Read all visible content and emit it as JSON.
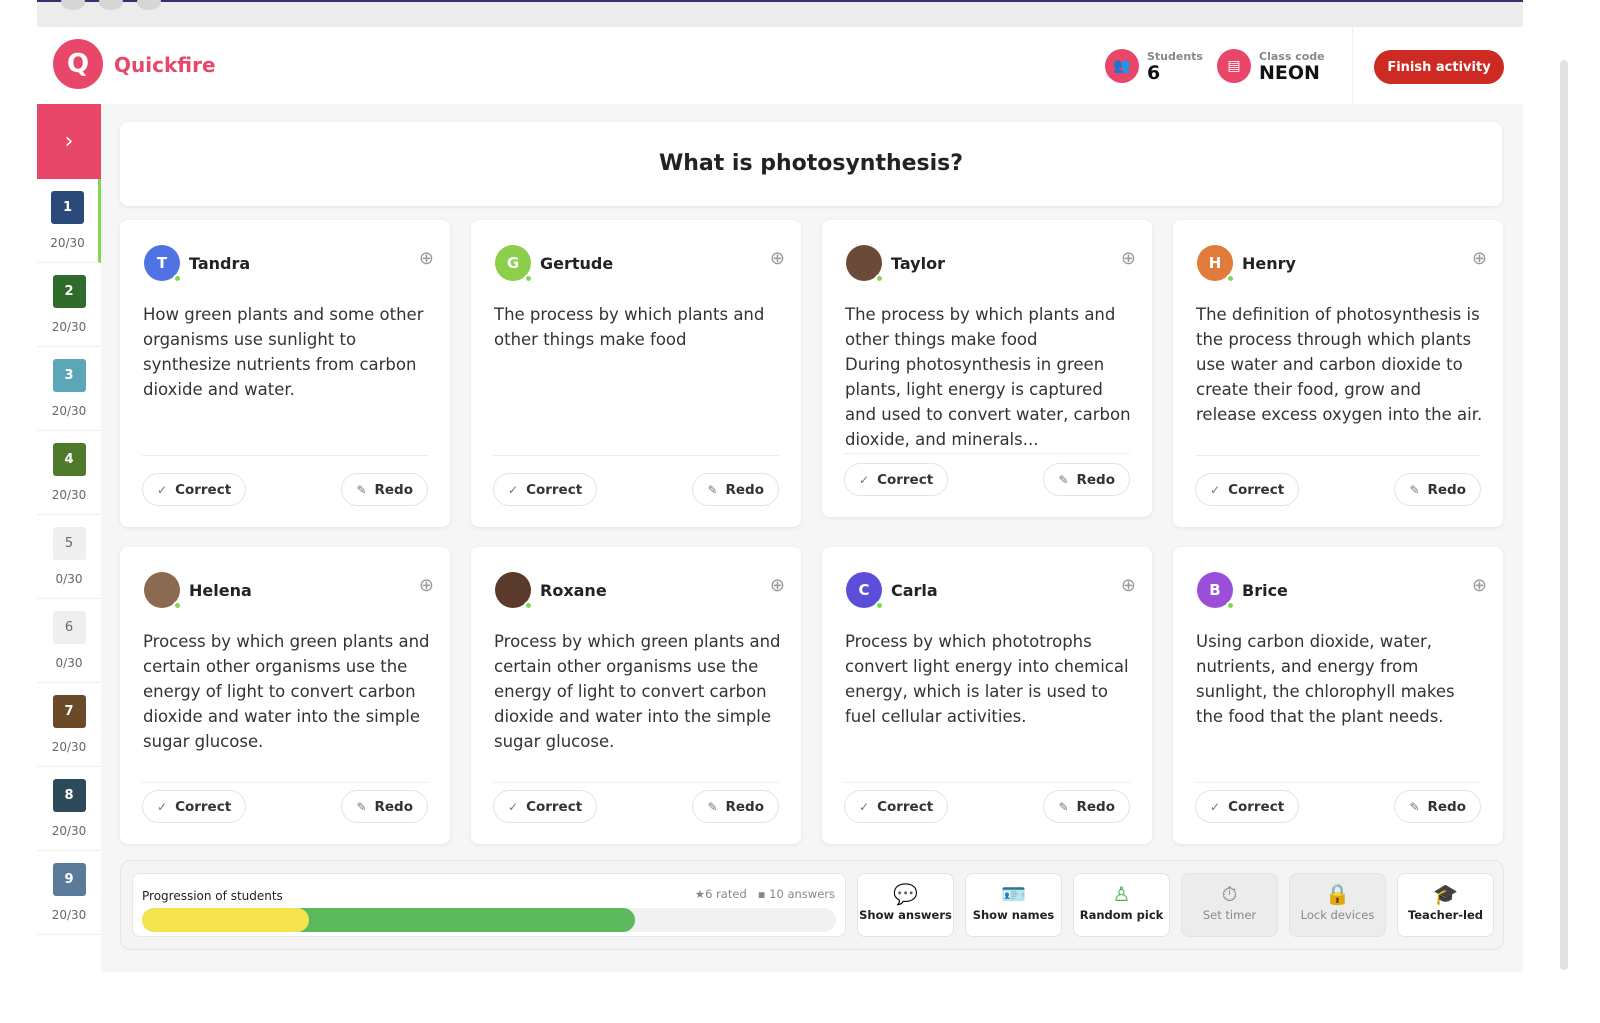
{
  "header": {
    "brand": "Quickfire",
    "students_label": "Students",
    "students_value": "6",
    "class_code_label": "Class code",
    "class_code_value": "NEON",
    "finish_label": "Finish activity"
  },
  "sidebar": {
    "items": [
      {
        "number": "1",
        "count": "20/30",
        "color": "#2b4a7a"
      },
      {
        "number": "2",
        "count": "20/30",
        "color": "#2f6b2a"
      },
      {
        "number": "3",
        "count": "20/30",
        "color": "#5ba7b8"
      },
      {
        "number": "4",
        "count": "20/30",
        "color": "#4f7a2c"
      },
      {
        "number": "5",
        "count": "0/30"
      },
      {
        "number": "6",
        "count": "0/30"
      },
      {
        "number": "7",
        "count": "20/30",
        "color": "#6b4a2a"
      },
      {
        "number": "8",
        "count": "20/30",
        "color": "#2d4a5a"
      },
      {
        "number": "9",
        "count": "20/30",
        "color": "#5a7a9a"
      }
    ]
  },
  "question": "What is photosynthesis?",
  "cards": [
    {
      "name": "Tandra",
      "initial": "T",
      "color": "#4f73e3",
      "answer": "How  green plants and some other organisms use sunlight to synthesize nutrients from carbon dioxide and water."
    },
    {
      "name": "Gertude",
      "initial": "G",
      "color": "#8bcf4a",
      "answer": "The process by which plants and other things make food"
    },
    {
      "name": "Taylor",
      "initial": "",
      "color": "#6b4a3a",
      "answer": "The process by which plants and other things make food\nDuring photosynthesis in green plants, light energy is captured and used to convert water, carbon dioxide, and minerals..."
    },
    {
      "name": "Henry",
      "initial": "H",
      "color": "#e07b3a",
      "answer": "The definition of photosynthesis is the process through which plants use water and carbon dioxide to create their food, grow and release excess oxygen into the air."
    },
    {
      "name": "Helena",
      "initial": "",
      "color": "#8a6a50",
      "answer": "Process by which green plants and certain other organisms use the energy of light to convert carbon dioxide and water into the simple sugar glucose."
    },
    {
      "name": "Roxane",
      "initial": "",
      "color": "#5a3a2a",
      "answer": "Process by which green plants and certain other organisms use the energy of light to convert carbon dioxide and water into the simple sugar glucose."
    },
    {
      "name": "Carla",
      "initial": "C",
      "color": "#5b4fd9",
      "answer": "Process by which phototrophs convert light energy into chemical energy, which is later is used to fuel cellular activities."
    },
    {
      "name": "Brice",
      "initial": "B",
      "color": "#9b4fd9",
      "answer": "Using carbon dioxide, water, nutrients, and energy from sunlight, the chlorophyll makes the food that the plant needs."
    }
  ],
  "card_buttons": {
    "correct": "Correct",
    "redo": "Redo"
  },
  "progress": {
    "title": "Progression of students",
    "rated": "6 rated",
    "answers": "10 answers",
    "rated_percent": 24,
    "answered_percent": 71,
    "colors": {
      "rated": "#f5e44e",
      "answered": "#5cb85c"
    }
  },
  "tools": [
    {
      "label": "Show answers",
      "icon": "chat-bubbles-icon",
      "glyph": "💬",
      "disabled": false
    },
    {
      "label": "Show names",
      "icon": "name-badge-icon",
      "glyph": "🪪",
      "disabled": false
    },
    {
      "label": "Random pick",
      "icon": "person-icon",
      "glyph": "♙",
      "disabled": false
    },
    {
      "label": "Set timer",
      "icon": "timer-icon",
      "glyph": "⏱",
      "disabled": true
    },
    {
      "label": "Lock devices",
      "icon": "lock-device-icon",
      "glyph": "🔒",
      "disabled": true
    },
    {
      "label": "Teacher-led",
      "icon": "graduation-cap-icon",
      "glyph": "🎓",
      "disabled": false
    }
  ]
}
